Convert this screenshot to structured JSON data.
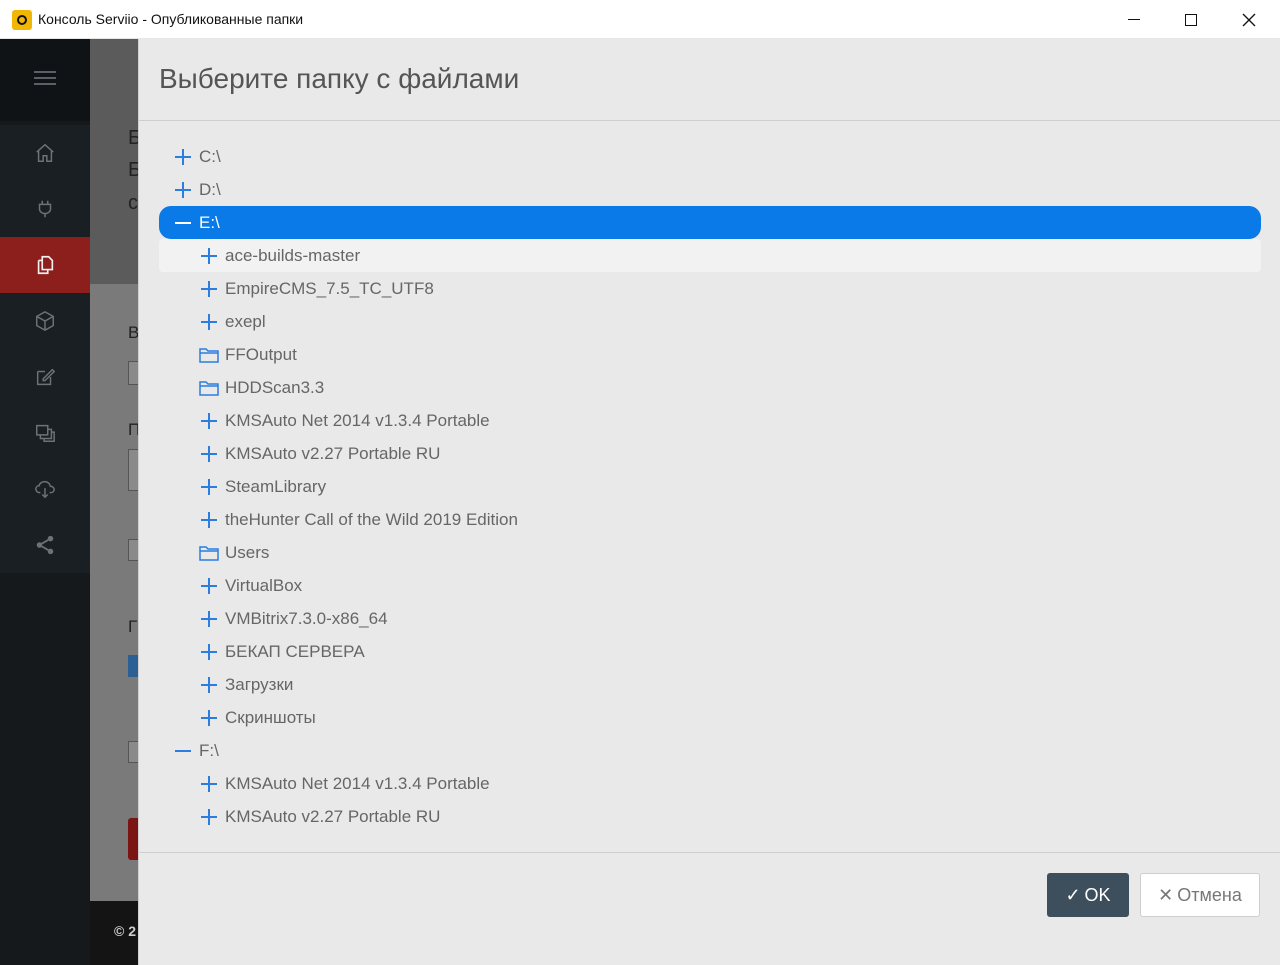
{
  "window": {
    "title": "Консоль Serviio - Опубликованные папки",
    "app_icon": "serviio-logo-icon",
    "controls": [
      "minimize-icon",
      "maximize-icon",
      "close-icon"
    ]
  },
  "sidebar": {
    "menu_icon": "hamburger-icon",
    "items": [
      {
        "icon": "home-icon"
      },
      {
        "icon": "plug-icon"
      },
      {
        "icon": "copy-folders-icon",
        "active": true
      },
      {
        "icon": "cube-icon"
      },
      {
        "icon": "edit-icon"
      },
      {
        "icon": "layers-icon"
      },
      {
        "icon": "cloud-icon"
      },
      {
        "icon": "share-icon"
      }
    ]
  },
  "background": {
    "fragments": [
      "Б",
      "Б",
      "с",
      "В",
      "П",
      "Г",
      "© 2"
    ]
  },
  "modal": {
    "title": "Выберите папку с файлами",
    "tree": [
      {
        "label": "C:\\",
        "level": 0,
        "toggle": "plus"
      },
      {
        "label": "D:\\",
        "level": 0,
        "toggle": "plus"
      },
      {
        "label": "E:\\",
        "level": 0,
        "toggle": "minus",
        "selected": true
      },
      {
        "label": "ace-builds-master",
        "level": 1,
        "toggle": "plus",
        "hover": true
      },
      {
        "label": "EmpireCMS_7.5_TC_UTF8",
        "level": 1,
        "toggle": "plus"
      },
      {
        "label": "exepl",
        "level": 1,
        "toggle": "plus"
      },
      {
        "label": "FFOutput",
        "level": 1,
        "toggle": "folder"
      },
      {
        "label": "HDDScan3.3",
        "level": 1,
        "toggle": "folder"
      },
      {
        "label": "KMSAuto Net 2014 v1.3.4 Portable",
        "level": 1,
        "toggle": "plus"
      },
      {
        "label": "KMSAuto v2.27 Portable RU",
        "level": 1,
        "toggle": "plus"
      },
      {
        "label": "SteamLibrary",
        "level": 1,
        "toggle": "plus"
      },
      {
        "label": "theHunter Call of the Wild 2019 Edition",
        "level": 1,
        "toggle": "plus"
      },
      {
        "label": "Users",
        "level": 1,
        "toggle": "folder"
      },
      {
        "label": "VirtualBox",
        "level": 1,
        "toggle": "plus"
      },
      {
        "label": "VMBitrix7.3.0-x86_64",
        "level": 1,
        "toggle": "plus"
      },
      {
        "label": "БЕКАП СЕРВЕРА",
        "level": 1,
        "toggle": "plus"
      },
      {
        "label": "Загрузки",
        "level": 1,
        "toggle": "plus"
      },
      {
        "label": "Скриншоты",
        "level": 1,
        "toggle": "plus"
      },
      {
        "label": "F:\\",
        "level": 0,
        "toggle": "minus"
      },
      {
        "label": "KMSAuto Net 2014 v1.3.4 Portable",
        "level": 1,
        "toggle": "plus"
      },
      {
        "label": "KMSAuto v2.27 Portable RU",
        "level": 1,
        "toggle": "plus"
      }
    ],
    "buttons": {
      "ok_glyph": "✓",
      "ok_label": "OK",
      "cancel_glyph": "✕",
      "cancel_label": "Отмена"
    }
  },
  "colors": {
    "selected": "#0a7ae8",
    "accent_active": "#8c1e1c",
    "ok_button": "#3d4f5c"
  }
}
